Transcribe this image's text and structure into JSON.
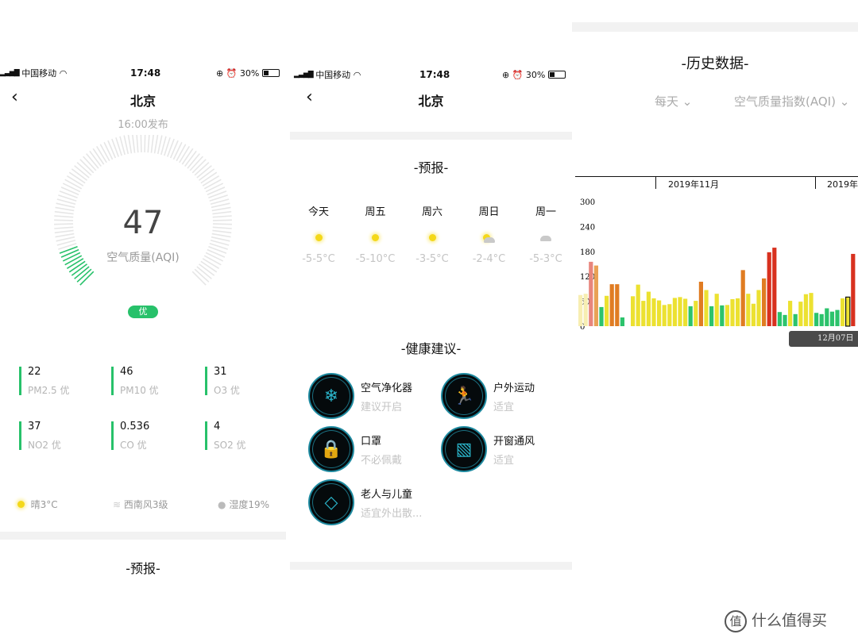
{
  "status_bar": {
    "carrier": "中国移动",
    "time": "17:48",
    "battery": "30%"
  },
  "screen1": {
    "title": "北京",
    "published": "16:00发布",
    "aqi": "47",
    "aqi_label": "空气质量(AQI)",
    "aqi_fraction": 0.094,
    "level": "优",
    "level_color": "#27c16a",
    "pollutants": [
      {
        "value": "22",
        "name": "PM2.5 优"
      },
      {
        "value": "46",
        "name": "PM10 优"
      },
      {
        "value": "31",
        "name": "O3 优"
      },
      {
        "value": "37",
        "name": "NO2 优"
      },
      {
        "value": "0.536",
        "name": "CO 优"
      },
      {
        "value": "4",
        "name": "SO2 优"
      }
    ],
    "weather": {
      "icon": "sun-icon",
      "text": "晴3°C"
    },
    "wind": {
      "icon": "wind-icon",
      "text": "西南风3级"
    },
    "humidity": {
      "icon": "droplet-icon",
      "text": "湿度19%"
    },
    "forecast_heading": "-预报-"
  },
  "screen2": {
    "title": "北京",
    "forecast_heading": "-预报-",
    "forecast": [
      {
        "day": "今天",
        "icon": "sun-icon",
        "temp": "-5-5°C"
      },
      {
        "day": "周五",
        "icon": "sun-icon",
        "temp": "-5-10°C"
      },
      {
        "day": "周六",
        "icon": "sun-icon",
        "temp": "-3-5°C"
      },
      {
        "day": "周日",
        "icon": "partly-cloudy-icon",
        "temp": "-2-4°C"
      },
      {
        "day": "周一",
        "icon": "cloud-icon",
        "temp": "-5-3°C"
      }
    ],
    "advice_heading": "-健康建议-",
    "advice": [
      {
        "title": "空气净化器",
        "desc": "建议开启",
        "icon": "air-purifier-icon"
      },
      {
        "title": "户外运动",
        "desc": "适宜",
        "icon": "running-icon"
      },
      {
        "title": "口罩",
        "desc": "不必佩戴",
        "icon": "mask-icon"
      },
      {
        "title": "开窗通风",
        "desc": "适宜",
        "icon": "window-icon"
      },
      {
        "title": "老人与儿童",
        "desc": "适宜外出散...",
        "icon": "stroller-icon"
      }
    ]
  },
  "screen3": {
    "title": "-历史数据-",
    "period": "每天",
    "metric": "空气质量指数(AQI)",
    "months": [
      "2019年11月",
      "2019年"
    ],
    "tooltip": "12月07日"
  },
  "chart_data": {
    "type": "bar",
    "ylim": [
      0,
      300
    ],
    "yticks": [
      "0",
      "60",
      "120",
      "180",
      "240",
      "300"
    ],
    "values": [
      75,
      78,
      155,
      146,
      46,
      73,
      101,
      101,
      21,
      null,
      72,
      100,
      61,
      83,
      67,
      62,
      51,
      53,
      68,
      70,
      66,
      48,
      61,
      107,
      87,
      48,
      78,
      50,
      51,
      65,
      67,
      135,
      78,
      54,
      87,
      115,
      178,
      189,
      34,
      27,
      61,
      29,
      59,
      77,
      80,
      32,
      29,
      43,
      35,
      39,
      67,
      70,
      174
    ],
    "colors": {
      "faded": "#f7eeb2",
      "pink": "#e8857c",
      "light_orange": "#e9a155",
      "good": "#2cc36c",
      "moderate": "#ece131",
      "unhealthy_sensitive": "#e07c22",
      "unhealthy": "#d8311f"
    },
    "selected_index": 51
  },
  "watermark": "什么值得买"
}
